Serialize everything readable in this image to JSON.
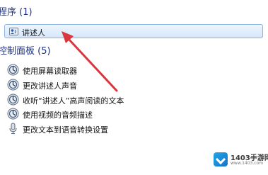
{
  "groups": {
    "programs": {
      "header": "程序 (1)",
      "items": [
        {
          "label": "讲述人",
          "icon": "narrator-program-icon"
        }
      ]
    },
    "control_panel": {
      "header": "控制面板 (5)",
      "items": [
        {
          "label": "使用屏幕读取器",
          "icon": "ease-of-access-icon"
        },
        {
          "label": "更改讲述人声音",
          "icon": "ease-of-access-icon"
        },
        {
          "label": "收听“讲述人”高声阅读的文本",
          "icon": "ease-of-access-icon"
        },
        {
          "label": "使用视频的音频描述",
          "icon": "ease-of-access-icon"
        },
        {
          "label": "更改文本到语音转换设置",
          "icon": "microphone-icon"
        }
      ]
    }
  },
  "annotation": {
    "arrow_color": "#d9363e"
  },
  "watermark": {
    "name": "1403手游网",
    "url": "www.1403.com"
  },
  "colors": {
    "group_header": "#1e3287",
    "selection_border": "#8eb4e3",
    "selection_fill": "#dbe9fb"
  }
}
